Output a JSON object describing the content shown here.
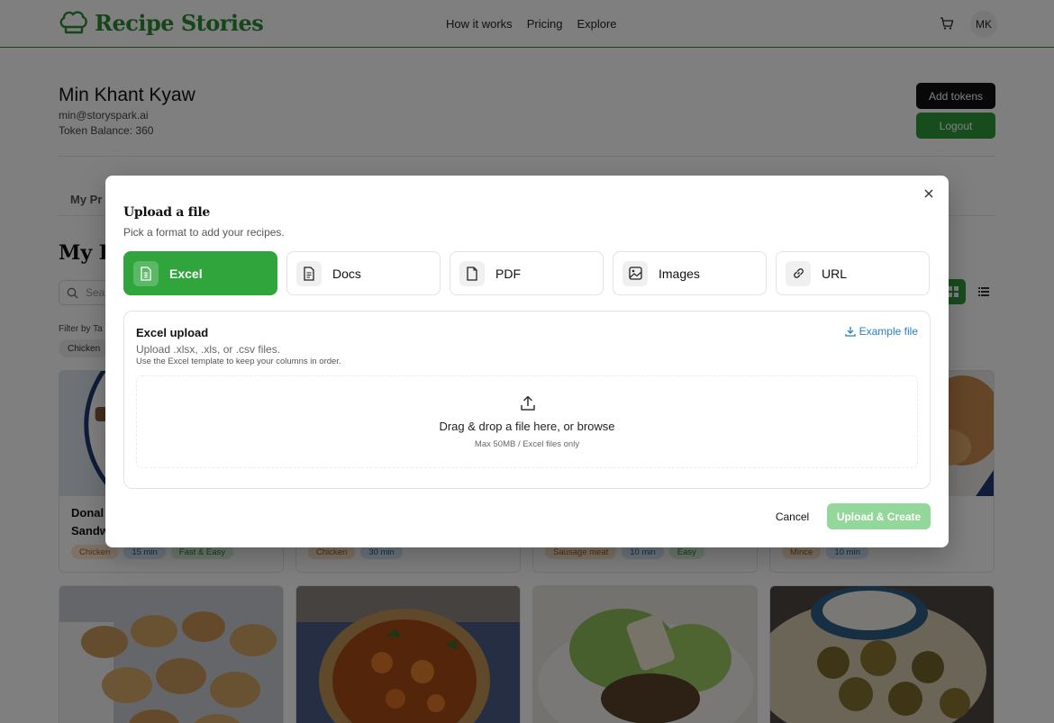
{
  "header": {
    "brand": "Recipe Stories",
    "nav": [
      "How it works",
      "Pricing",
      "Explore"
    ],
    "avatar_initials": "MK"
  },
  "profile": {
    "name": "Min Khant Kyaw",
    "email": "min@storyspark.ai",
    "tokens": "Token Balance: 360",
    "add_tokens_label": "Add tokens",
    "logout_label": "Logout"
  },
  "page": {
    "tab_first": "My Pr",
    "section_title": "My R",
    "search_placeholder": "Sea",
    "filter_label": "Filter by Ta",
    "filter_chip": "Chicken"
  },
  "cards_row1": [
    {
      "title": "Donal\nSandw",
      "tags": [
        "Chicken",
        "15 min",
        "Fast & Easy"
      ]
    },
    {
      "title": "",
      "tags": [
        "Chicken",
        "30 min"
      ]
    },
    {
      "title": "",
      "tags": [
        "Sausage meat",
        "10 min",
        "Easy"
      ]
    },
    {
      "title": "",
      "tags": [
        "Mince",
        "10 min"
      ]
    }
  ],
  "modal": {
    "title": "Upload a file",
    "subtitle": "Pick a format to add your recipes.",
    "formats": [
      {
        "label": "Excel",
        "icon": "spreadsheet-icon",
        "active": true
      },
      {
        "label": "Docs",
        "icon": "document-icon",
        "active": false
      },
      {
        "label": "PDF",
        "icon": "file-icon",
        "active": false
      },
      {
        "label": "Images",
        "icon": "image-icon",
        "active": false
      },
      {
        "label": "URL",
        "icon": "link-icon",
        "active": false
      }
    ],
    "panel": {
      "title": "Excel upload",
      "subtitle": "Upload .xlsx, .xls, or .csv files.",
      "hint": "Use the Excel template to keep your columns in order.",
      "example_link": "Example file",
      "dropzone_text": "Drag & drop a file here, or browse",
      "dropzone_note": "Max 50MB / Excel files only"
    },
    "cancel_label": "Cancel",
    "upload_label": "Upload & Create"
  },
  "colors": {
    "brand_green": "#2a8a32",
    "active_green": "#2fa53c",
    "link_blue": "#2a7fc4"
  }
}
